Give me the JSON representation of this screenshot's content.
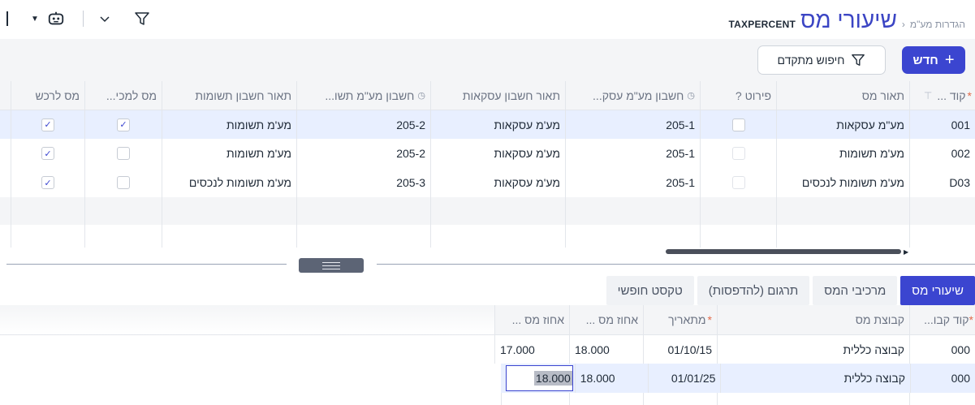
{
  "header": {
    "breadcrumb": "הגדרות מע\"מ",
    "separator": "‹",
    "title": "שיעורי מס",
    "code": "TAXPERCENT"
  },
  "toolbar": {
    "dropdown_icon": "caret-down-icon",
    "robot_icon": "robot-icon",
    "chevron_icon": "chevron-down-icon",
    "filter_icon": "filter-icon"
  },
  "actions": {
    "new_label": "חדש",
    "new_plus": "+",
    "search_label": "חיפוש מתקדם"
  },
  "main_grid": {
    "headers": {
      "code": "קוד ...",
      "tax_desc": "תאור מס",
      "detail": "פירוט ?",
      "acc_deals": "חשבון מע\"מ עסק...",
      "acc_deals_desc": "תאור חשבון עסקאות",
      "acc_inputs": "חשבון מע\"מ תשו...",
      "acc_inputs_desc": "תאור חשבון תשומות",
      "tax_sale": "מס למכי...",
      "tax_buy": "מס לרכש"
    },
    "rows": [
      {
        "code": "001",
        "tax_desc": "מע\"מ עסקאות",
        "acc_deals": "205-1",
        "acc_deals_desc": "מע'מ עסקאות",
        "acc_inputs": "205-2",
        "acc_inputs_desc": "מע'מ תשומות",
        "tax_sale": "✓",
        "tax_buy": "✓"
      },
      {
        "code": "002",
        "tax_desc": "מע'מ תשומות",
        "acc_deals": "205-1",
        "acc_deals_desc": "מע'מ עסקאות",
        "acc_inputs": "205-2",
        "acc_inputs_desc": "מע'מ תשומות",
        "tax_sale": "",
        "tax_buy": "✓"
      },
      {
        "code": "D03",
        "tax_desc": "מע'מ תשומות לנכסים",
        "acc_deals": "205-1",
        "acc_deals_desc": "מע'מ עסקאות",
        "acc_inputs": "205-3",
        "acc_inputs_desc": "מע'מ תשומות לנכסים",
        "tax_sale": "",
        "tax_buy": "✓"
      }
    ]
  },
  "tabs": [
    "שיעורי מס",
    "מרכיבי המס",
    "תרגום (להדפסות)",
    "טקסט חופשי"
  ],
  "sub_grid": {
    "headers": {
      "group_code": "קוד קבו...",
      "tax_group": "קבוצת מס",
      "from_date": "מתאריך",
      "pct1": "אחוז מס ...",
      "pct2": "אחוז מס ..."
    },
    "rows": [
      {
        "group_code": "000",
        "tax_group": "קבוצה כללית",
        "from_date": "01/10/15",
        "pct1": "18.000",
        "pct2": "17.000"
      },
      {
        "group_code": "000",
        "tax_group": "קבוצה כללית",
        "from_date": "01/01/25",
        "pct1": "18.000",
        "pct2": "18.000"
      }
    ]
  }
}
